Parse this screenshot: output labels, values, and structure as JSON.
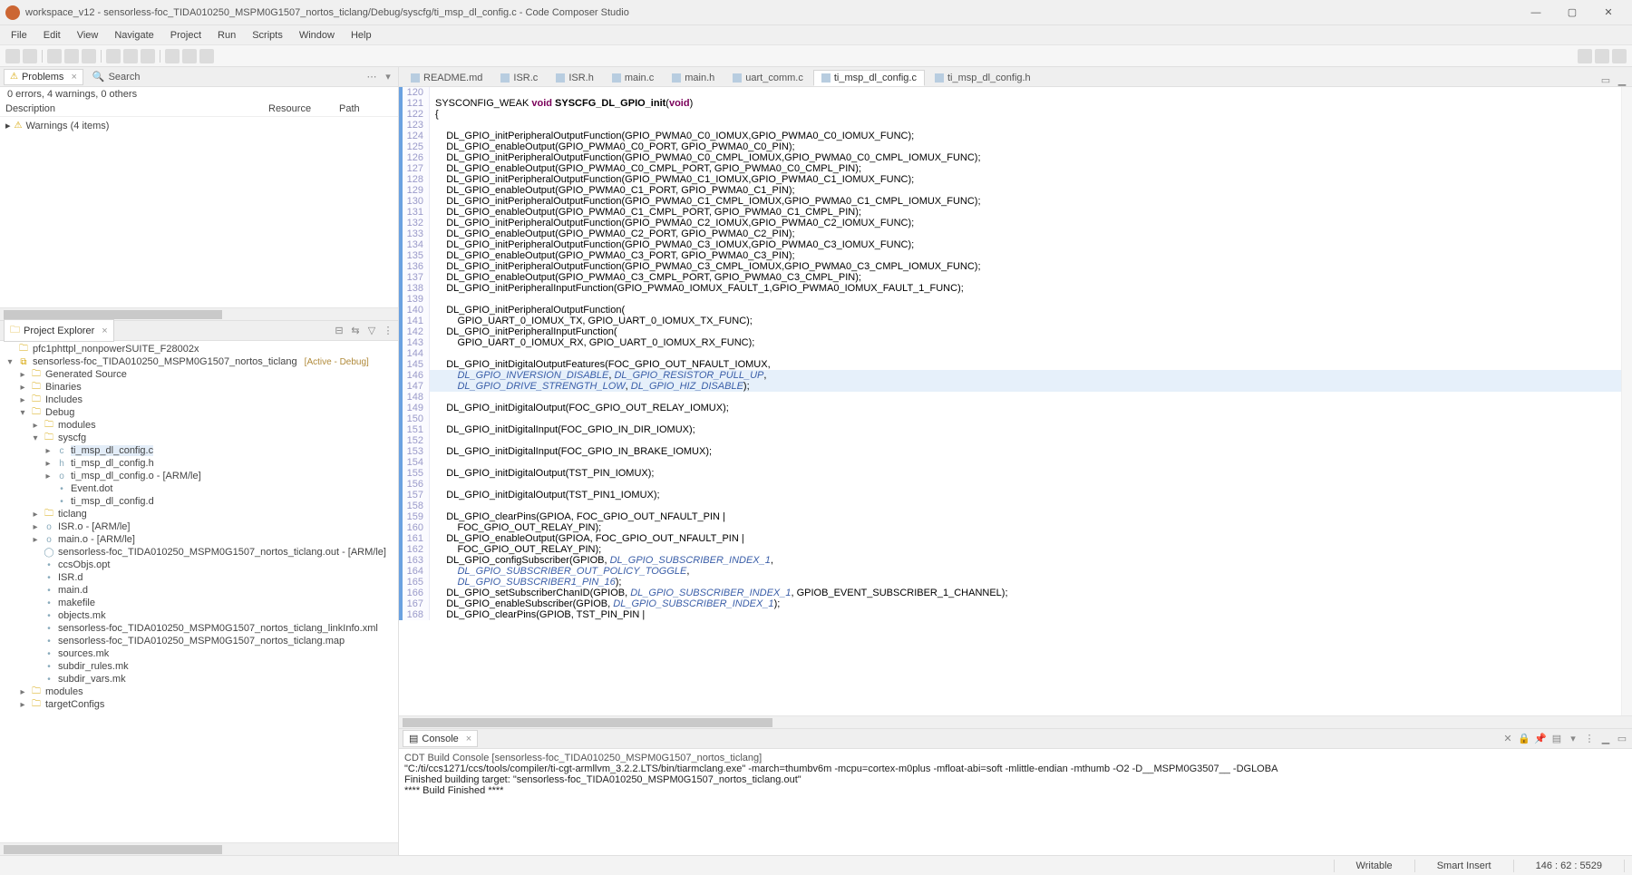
{
  "window": {
    "title": "workspace_v12 - sensorless-foc_TIDA010250_MSPM0G1507_nortos_ticlang/Debug/syscfg/ti_msp_dl_config.c - Code Composer Studio"
  },
  "menubar": [
    "File",
    "Edit",
    "View",
    "Navigate",
    "Project",
    "Run",
    "Scripts",
    "Window",
    "Help"
  ],
  "problems": {
    "tabs": [
      "Problems",
      "Search"
    ],
    "active_tab": 0,
    "status": "0 errors, 4 warnings, 0 others",
    "columns": [
      "Description",
      "Resource",
      "Path"
    ],
    "rows": [
      {
        "icon": "warning",
        "label": "Warnings (4 items)"
      }
    ]
  },
  "explorer": {
    "title": "Project Explorer",
    "rows": [
      {
        "indent": 0,
        "caret": "",
        "icon": "folder",
        "label": "pfc1phttpl_nonpowerSUITE_F28002x"
      },
      {
        "indent": 0,
        "caret": "▾",
        "icon": "project",
        "label": "sensorless-foc_TIDA010250_MSPM0G1507_nortos_ticlang",
        "hint": "[Active - Debug]"
      },
      {
        "indent": 1,
        "caret": "▸",
        "icon": "folder",
        "label": "Generated Source"
      },
      {
        "indent": 1,
        "caret": "▸",
        "icon": "folder",
        "label": "Binaries"
      },
      {
        "indent": 1,
        "caret": "▸",
        "icon": "folder",
        "label": "Includes"
      },
      {
        "indent": 1,
        "caret": "▾",
        "icon": "folder",
        "label": "Debug"
      },
      {
        "indent": 2,
        "caret": "▸",
        "icon": "folder",
        "label": "modules"
      },
      {
        "indent": 2,
        "caret": "▾",
        "icon": "folder",
        "label": "syscfg"
      },
      {
        "indent": 3,
        "caret": "▸",
        "icon": "cfile",
        "label": "ti_msp_dl_config.c",
        "selected": true
      },
      {
        "indent": 3,
        "caret": "▸",
        "icon": "hfile",
        "label": "ti_msp_dl_config.h"
      },
      {
        "indent": 3,
        "caret": "▸",
        "icon": "ofile",
        "label": "ti_msp_dl_config.o - [ARM/le]"
      },
      {
        "indent": 3,
        "caret": "",
        "icon": "file",
        "label": "Event.dot"
      },
      {
        "indent": 3,
        "caret": "",
        "icon": "file",
        "label": "ti_msp_dl_config.d"
      },
      {
        "indent": 2,
        "caret": "▸",
        "icon": "folder",
        "label": "ticlang"
      },
      {
        "indent": 2,
        "caret": "▸",
        "icon": "ofile",
        "label": "ISR.o - [ARM/le]"
      },
      {
        "indent": 2,
        "caret": "▸",
        "icon": "ofile",
        "label": "main.o - [ARM/le]"
      },
      {
        "indent": 2,
        "caret": "",
        "icon": "out",
        "label": "sensorless-foc_TIDA010250_MSPM0G1507_nortos_ticlang.out - [ARM/le]"
      },
      {
        "indent": 2,
        "caret": "",
        "icon": "file",
        "label": "ccsObjs.opt"
      },
      {
        "indent": 2,
        "caret": "",
        "icon": "file",
        "label": "ISR.d"
      },
      {
        "indent": 2,
        "caret": "",
        "icon": "file",
        "label": "main.d"
      },
      {
        "indent": 2,
        "caret": "",
        "icon": "file",
        "label": "makefile"
      },
      {
        "indent": 2,
        "caret": "",
        "icon": "file",
        "label": "objects.mk"
      },
      {
        "indent": 2,
        "caret": "",
        "icon": "file",
        "label": "sensorless-foc_TIDA010250_MSPM0G1507_nortos_ticlang_linkInfo.xml"
      },
      {
        "indent": 2,
        "caret": "",
        "icon": "file",
        "label": "sensorless-foc_TIDA010250_MSPM0G1507_nortos_ticlang.map"
      },
      {
        "indent": 2,
        "caret": "",
        "icon": "file",
        "label": "sources.mk"
      },
      {
        "indent": 2,
        "caret": "",
        "icon": "file",
        "label": "subdir_rules.mk"
      },
      {
        "indent": 2,
        "caret": "",
        "icon": "file",
        "label": "subdir_vars.mk"
      },
      {
        "indent": 1,
        "caret": "▸",
        "icon": "folder",
        "label": "modules"
      },
      {
        "indent": 1,
        "caret": "▸",
        "icon": "folder",
        "label": "targetConfigs"
      }
    ]
  },
  "editor": {
    "tabs": [
      {
        "label": "README.md"
      },
      {
        "label": "ISR.c"
      },
      {
        "label": "ISR.h"
      },
      {
        "label": "main.c"
      },
      {
        "label": "main.h"
      },
      {
        "label": "uart_comm.c"
      },
      {
        "label": "ti_msp_dl_config.c",
        "active": true
      },
      {
        "label": "ti_msp_dl_config.h"
      }
    ],
    "highlight_lines": [
      146,
      147
    ],
    "lines": [
      {
        "n": 120,
        "t": ""
      },
      {
        "n": 121,
        "html": "SYSCONFIG_WEAK <span class='kw1'>void</span> <span class='fn'>SYSCFG_DL_GPIO_init</span>(<span class='kw2'>void</span>)"
      },
      {
        "n": 122,
        "t": "{"
      },
      {
        "n": 123,
        "t": ""
      },
      {
        "n": 124,
        "t": "    DL_GPIO_initPeripheralOutputFunction(GPIO_PWMA0_C0_IOMUX,GPIO_PWMA0_C0_IOMUX_FUNC);"
      },
      {
        "n": 125,
        "t": "    DL_GPIO_enableOutput(GPIO_PWMA0_C0_PORT, GPIO_PWMA0_C0_PIN);"
      },
      {
        "n": 126,
        "t": "    DL_GPIO_initPeripheralOutputFunction(GPIO_PWMA0_C0_CMPL_IOMUX,GPIO_PWMA0_C0_CMPL_IOMUX_FUNC);"
      },
      {
        "n": 127,
        "t": "    DL_GPIO_enableOutput(GPIO_PWMA0_C0_CMPL_PORT, GPIO_PWMA0_C0_CMPL_PIN);"
      },
      {
        "n": 128,
        "t": "    DL_GPIO_initPeripheralOutputFunction(GPIO_PWMA0_C1_IOMUX,GPIO_PWMA0_C1_IOMUX_FUNC);"
      },
      {
        "n": 129,
        "t": "    DL_GPIO_enableOutput(GPIO_PWMA0_C1_PORT, GPIO_PWMA0_C1_PIN);"
      },
      {
        "n": 130,
        "t": "    DL_GPIO_initPeripheralOutputFunction(GPIO_PWMA0_C1_CMPL_IOMUX,GPIO_PWMA0_C1_CMPL_IOMUX_FUNC);"
      },
      {
        "n": 131,
        "t": "    DL_GPIO_enableOutput(GPIO_PWMA0_C1_CMPL_PORT, GPIO_PWMA0_C1_CMPL_PIN);"
      },
      {
        "n": 132,
        "t": "    DL_GPIO_initPeripheralOutputFunction(GPIO_PWMA0_C2_IOMUX,GPIO_PWMA0_C2_IOMUX_FUNC);"
      },
      {
        "n": 133,
        "t": "    DL_GPIO_enableOutput(GPIO_PWMA0_C2_PORT, GPIO_PWMA0_C2_PIN);"
      },
      {
        "n": 134,
        "t": "    DL_GPIO_initPeripheralOutputFunction(GPIO_PWMA0_C3_IOMUX,GPIO_PWMA0_C3_IOMUX_FUNC);"
      },
      {
        "n": 135,
        "t": "    DL_GPIO_enableOutput(GPIO_PWMA0_C3_PORT, GPIO_PWMA0_C3_PIN);"
      },
      {
        "n": 136,
        "t": "    DL_GPIO_initPeripheralOutputFunction(GPIO_PWMA0_C3_CMPL_IOMUX,GPIO_PWMA0_C3_CMPL_IOMUX_FUNC);"
      },
      {
        "n": 137,
        "t": "    DL_GPIO_enableOutput(GPIO_PWMA0_C3_CMPL_PORT, GPIO_PWMA0_C3_CMPL_PIN);"
      },
      {
        "n": 138,
        "t": "    DL_GPIO_initPeripheralInputFunction(GPIO_PWMA0_IOMUX_FAULT_1,GPIO_PWMA0_IOMUX_FAULT_1_FUNC);"
      },
      {
        "n": 139,
        "t": ""
      },
      {
        "n": 140,
        "t": "    DL_GPIO_initPeripheralOutputFunction("
      },
      {
        "n": 141,
        "t": "        GPIO_UART_0_IOMUX_TX, GPIO_UART_0_IOMUX_TX_FUNC);"
      },
      {
        "n": 142,
        "t": "    DL_GPIO_initPeripheralInputFunction("
      },
      {
        "n": 143,
        "t": "        GPIO_UART_0_IOMUX_RX, GPIO_UART_0_IOMUX_RX_FUNC);"
      },
      {
        "n": 144,
        "t": ""
      },
      {
        "n": 145,
        "t": "    DL_GPIO_initDigitalOutputFeatures(FOC_GPIO_OUT_NFAULT_IOMUX,"
      },
      {
        "n": 146,
        "html": "        <span class='mac'>DL_GPIO_INVERSION_DISABLE</span>, <span class='mac'>DL_GPIO_RESISTOR_PULL_UP</span>,"
      },
      {
        "n": 147,
        "html": "        <span class='mac'>DL_GPIO_DRIVE_STRENGTH_LOW</span>, <span class='mac'>DL_GPIO_HIZ_DISABLE</span>);"
      },
      {
        "n": 148,
        "t": ""
      },
      {
        "n": 149,
        "t": "    DL_GPIO_initDigitalOutput(FOC_GPIO_OUT_RELAY_IOMUX);"
      },
      {
        "n": 150,
        "t": ""
      },
      {
        "n": 151,
        "t": "    DL_GPIO_initDigitalInput(FOC_GPIO_IN_DIR_IOMUX);"
      },
      {
        "n": 152,
        "t": ""
      },
      {
        "n": 153,
        "t": "    DL_GPIO_initDigitalInput(FOC_GPIO_IN_BRAKE_IOMUX);"
      },
      {
        "n": 154,
        "t": ""
      },
      {
        "n": 155,
        "t": "    DL_GPIO_initDigitalOutput(TST_PIN_IOMUX);"
      },
      {
        "n": 156,
        "t": ""
      },
      {
        "n": 157,
        "t": "    DL_GPIO_initDigitalOutput(TST_PIN1_IOMUX);"
      },
      {
        "n": 158,
        "t": ""
      },
      {
        "n": 159,
        "t": "    DL_GPIO_clearPins(GPIOA, FOC_GPIO_OUT_NFAULT_PIN |"
      },
      {
        "n": 160,
        "t": "        FOC_GPIO_OUT_RELAY_PIN);"
      },
      {
        "n": 161,
        "t": "    DL_GPIO_enableOutput(GPIOA, FOC_GPIO_OUT_NFAULT_PIN |"
      },
      {
        "n": 162,
        "t": "        FOC_GPIO_OUT_RELAY_PIN);"
      },
      {
        "n": 163,
        "html": "    DL_GPIO_configSubscriber(GPIOB, <span class='mac'>DL_GPIO_SUBSCRIBER_INDEX_1</span>,"
      },
      {
        "n": 164,
        "html": "        <span class='mac'>DL_GPIO_SUBSCRIBER_OUT_POLICY_TOGGLE</span>,"
      },
      {
        "n": 165,
        "html": "        <span class='mac'>DL_GPIO_SUBSCRIBER1_PIN_16</span>);"
      },
      {
        "n": 166,
        "html": "    DL_GPIO_setSubscriberChanID(GPIOB, <span class='mac'>DL_GPIO_SUBSCRIBER_INDEX_1</span>, GPIOB_EVENT_SUBSCRIBER_1_CHANNEL);"
      },
      {
        "n": 167,
        "html": "    DL_GPIO_enableSubscriber(GPIOB, <span class='mac'>DL_GPIO_SUBSCRIBER_INDEX_1</span>);"
      },
      {
        "n": 168,
        "t": "    DL_GPIO_clearPins(GPIOB, TST_PIN_PIN |"
      }
    ]
  },
  "console": {
    "title": "Console",
    "header": "CDT Build Console [sensorless-foc_TIDA010250_MSPM0G1507_nortos_ticlang]",
    "lines": [
      "\"C:/ti/ccs1271/ccs/tools/compiler/ti-cgt-armllvm_3.2.2.LTS/bin/tiarmclang.exe\"  -march=thumbv6m -mcpu=cortex-m0plus -mfloat-abi=soft -mlittle-endian -mthumb -O2 -D__MSPM0G3507__  -DGLOBA",
      "Finished building target: \"sensorless-foc_TIDA010250_MSPM0G1507_nortos_ticlang.out\"",
      "",
      "**** Build Finished ****"
    ]
  },
  "status": {
    "writable": "Writable",
    "insert": "Smart Insert",
    "pos": "146 : 62 : 5529"
  }
}
